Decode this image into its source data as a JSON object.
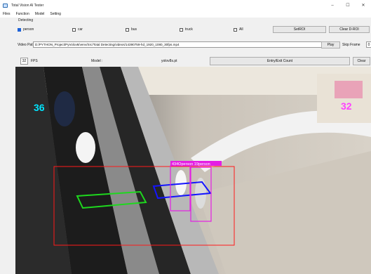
{
  "window": {
    "title": "Total Vision AI Tester",
    "controls": {
      "minimize": "–",
      "maximize": "☐",
      "close": "✕"
    }
  },
  "menu": [
    "Files",
    "Function",
    "Model",
    "Setting"
  ],
  "detecting": {
    "group_label": "Detecting",
    "classes": [
      {
        "label": "person",
        "checked": true
      },
      {
        "label": "car",
        "checked": false
      },
      {
        "label": "bus",
        "checked": false
      },
      {
        "label": "truck",
        "checked": false
      },
      {
        "label": "All",
        "checked": false
      }
    ],
    "set_roi_label": "SetROI",
    "clear_roi_label": "Clear D-ROI"
  },
  "video_path": {
    "label": "Video Path",
    "value": "D:/PYTHON_Project/PyVolov8/venv/Src/Total Detecting/videos/14390759-hd_1920_1080_30fps.mp4",
    "play_label": "Play",
    "skip_label": "Skip Frame",
    "skip_value": "0"
  },
  "status": {
    "fps_value": "32",
    "fps_label": "FPS",
    "model_label": "Model :",
    "model_value": "yolov8s.pt",
    "entry_exit_label": "Entry/Exit Count",
    "clear_label": "Clear"
  },
  "overlay": {
    "left_count": "36",
    "right_count": "32",
    "detection_label": "434Operson 19person",
    "colors": {
      "roi": "#ff1a1a",
      "lane_left": "#1ed81e",
      "lane_right": "#1515ff",
      "person_box": "#e41ee4",
      "count_left": "#00e5ff",
      "count_right": "#ff40ff"
    }
  }
}
